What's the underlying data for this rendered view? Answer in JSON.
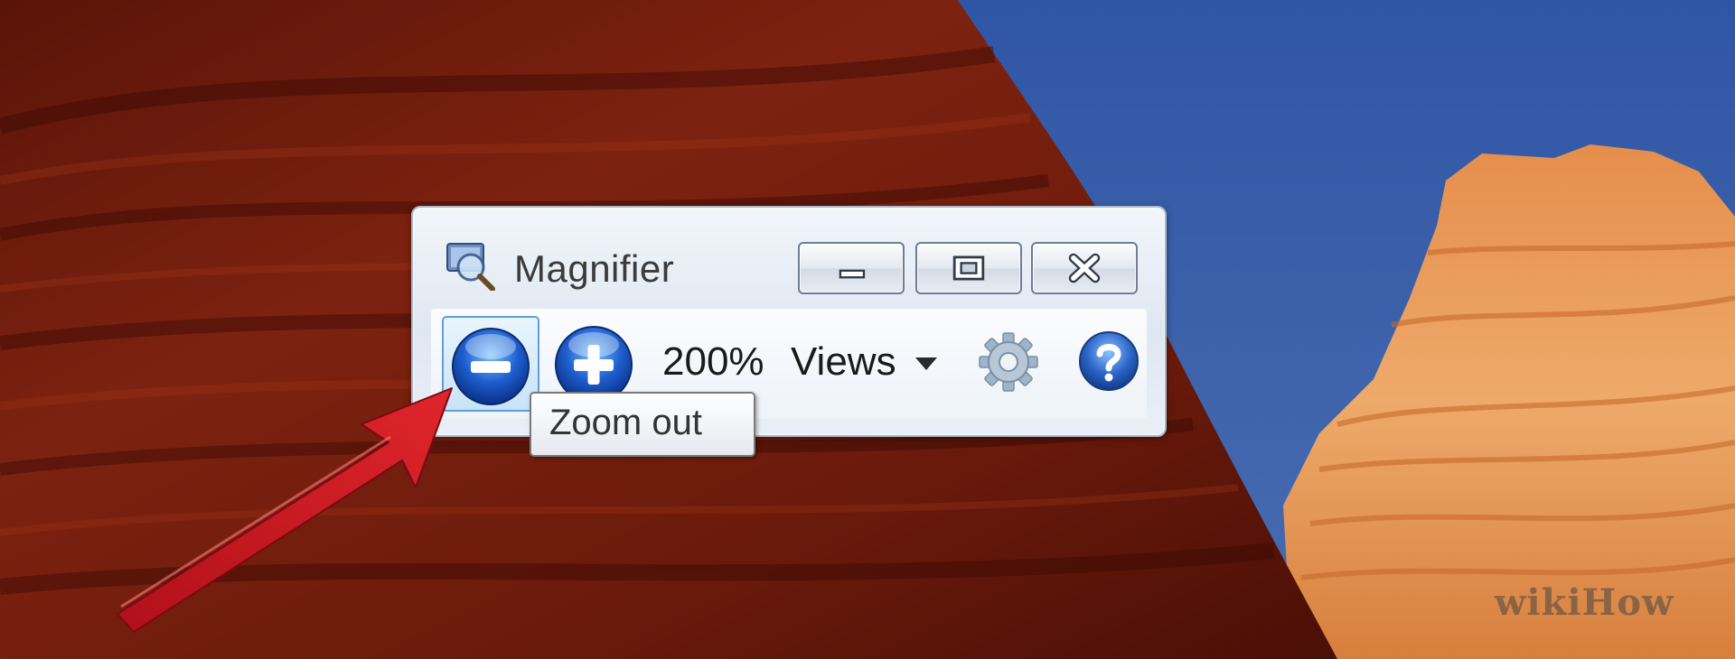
{
  "desktop": {
    "watermark_text": "wikiHow",
    "colors": {
      "rock_dark": "#3d0a05",
      "rock_mid": "#7a1e10",
      "sky": "#3d5fa3",
      "sandstone": "#e0894a",
      "arrow": "#c3121c"
    }
  },
  "magnifier": {
    "title": "Magnifier",
    "app_icon": "magnifier-icon",
    "window_buttons": {
      "minimize_icon": "minimize-icon",
      "maximize_icon": "restore-icon",
      "close_icon": "close-icon"
    },
    "toolbar": {
      "zoom_out_icon": "minus-circle-icon",
      "zoom_in_icon": "plus-circle-icon",
      "zoom_level": "200%",
      "views_label": "Views",
      "views_caret_icon": "caret-down-icon",
      "settings_icon": "gear-icon",
      "help_icon": "help-icon"
    },
    "tooltip": "Zoom out",
    "accent_color": "#1e5fcf"
  },
  "annotation": {
    "arrow_icon": "red-arrow-icon"
  }
}
